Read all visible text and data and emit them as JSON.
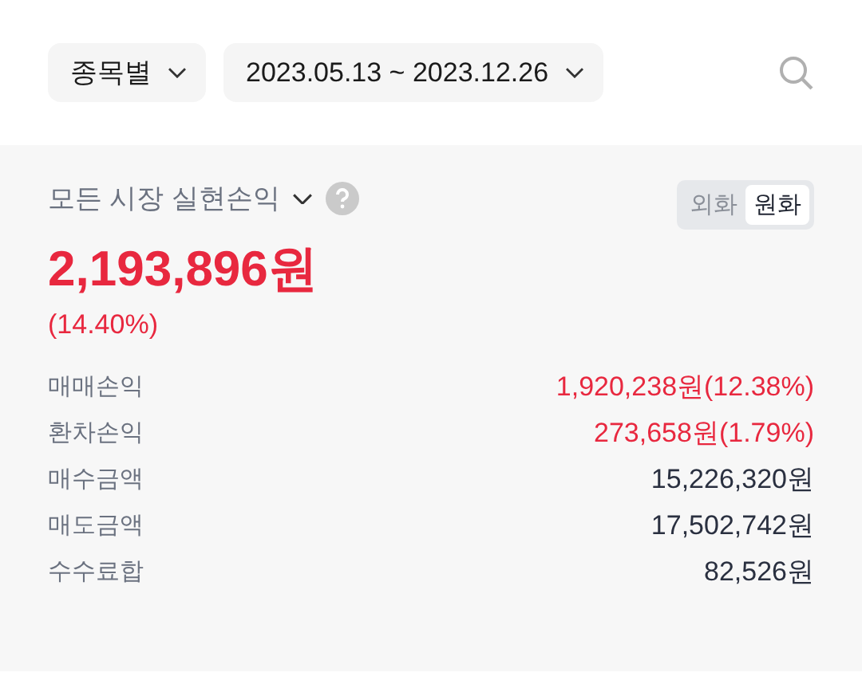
{
  "filters": [
    {
      "label": "종목별"
    },
    {
      "label": "2023.05.13 ~ 2023.12.26"
    }
  ],
  "summary": {
    "title": "모든 시장 실현손익",
    "currency_tabs": [
      {
        "label": "외화",
        "selected": false
      },
      {
        "label": "원화",
        "selected": true
      }
    ],
    "total": "2,193,896원",
    "rate": "(14.40%)"
  },
  "rows": [
    {
      "label": "매매손익",
      "value": "1,920,238원(12.38%)",
      "color": "#e8283f"
    },
    {
      "label": "환차손익",
      "value": "273,658원(1.79%)",
      "color": "#e8283f"
    },
    {
      "label": "매수금액",
      "value": "15,226,320원",
      "color": "#2a3040"
    },
    {
      "label": "매도금액",
      "value": "17,502,742원",
      "color": "#2a3040"
    },
    {
      "label": "수수료합",
      "value": "82,526원",
      "color": "#2a3040"
    }
  ]
}
